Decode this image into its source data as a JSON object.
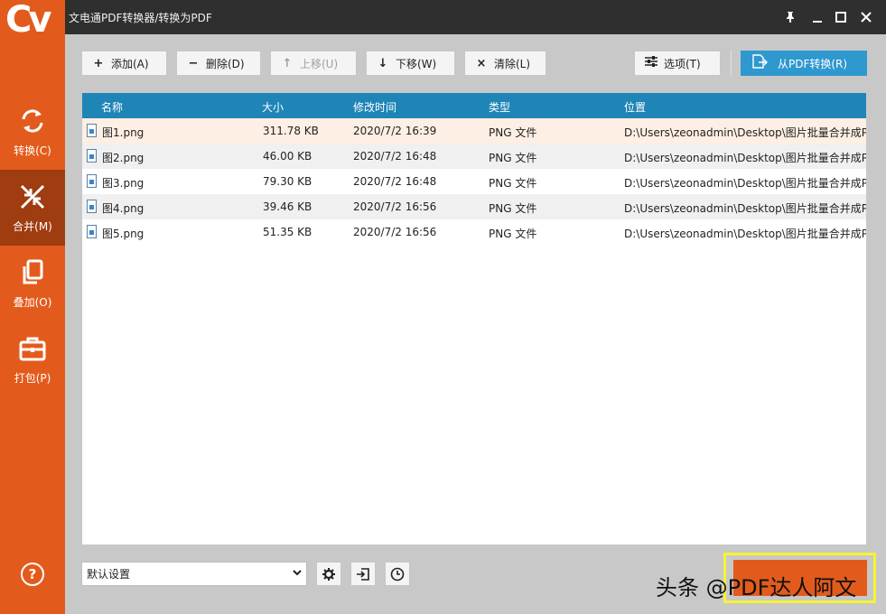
{
  "window": {
    "title": "文电通PDF转换器/转换为PDF",
    "logo_text": "Cv"
  },
  "window_controls": {
    "pin": "pin-icon",
    "minimize": "minimize-icon",
    "maximize": "maximize-icon",
    "close": "close-icon"
  },
  "sidebar": {
    "items": [
      {
        "label": "转换(C)",
        "icon": "refresh-icon",
        "active": false
      },
      {
        "label": "合并(M)",
        "icon": "merge-icon",
        "active": true
      },
      {
        "label": "叠加(O)",
        "icon": "copy-icon",
        "active": false
      },
      {
        "label": "打包(P)",
        "icon": "briefcase-icon",
        "active": false
      }
    ],
    "help_label": "?"
  },
  "toolbar": {
    "add_label": "添加(A)",
    "delete_label": "删除(D)",
    "move_up_label": "上移(U)",
    "move_down_label": "下移(W)",
    "clear_label": "清除(L)",
    "options_label": "选项(T)",
    "from_pdf_label": "从PDF转换(R)"
  },
  "table": {
    "headers": [
      "名称",
      "大小",
      "修改时间",
      "类型",
      "位置"
    ],
    "rows": [
      {
        "name": "图1.png",
        "size": "311.78 KB",
        "modified": "2020/7/2 16:39",
        "type": "PNG 文件",
        "location": "D:\\Users\\zeonadmin\\Desktop\\图片批量合并成PDF"
      },
      {
        "name": "图2.png",
        "size": "46.00 KB",
        "modified": "2020/7/2 16:48",
        "type": "PNG 文件",
        "location": "D:\\Users\\zeonadmin\\Desktop\\图片批量合并成PDF"
      },
      {
        "name": "图3.png",
        "size": "79.30 KB",
        "modified": "2020/7/2 16:48",
        "type": "PNG 文件",
        "location": "D:\\Users\\zeonadmin\\Desktop\\图片批量合并成PDF"
      },
      {
        "name": "图4.png",
        "size": "39.46 KB",
        "modified": "2020/7/2 16:56",
        "type": "PNG 文件",
        "location": "D:\\Users\\zeonadmin\\Desktop\\图片批量合并成PDF"
      },
      {
        "name": "图5.png",
        "size": "51.35 KB",
        "modified": "2020/7/2 16:56",
        "type": "PNG 文件",
        "location": "D:\\Users\\zeonadmin\\Desktop\\图片批量合并成PDF"
      }
    ]
  },
  "bottom": {
    "profile_value": "默认设置"
  },
  "watermark": "头条 @PDF达人阿文",
  "colors": {
    "accent": "#e35b1c",
    "header": "#1e85b6",
    "primary_button": "#2e98cf",
    "highlight": "#f5f531"
  }
}
